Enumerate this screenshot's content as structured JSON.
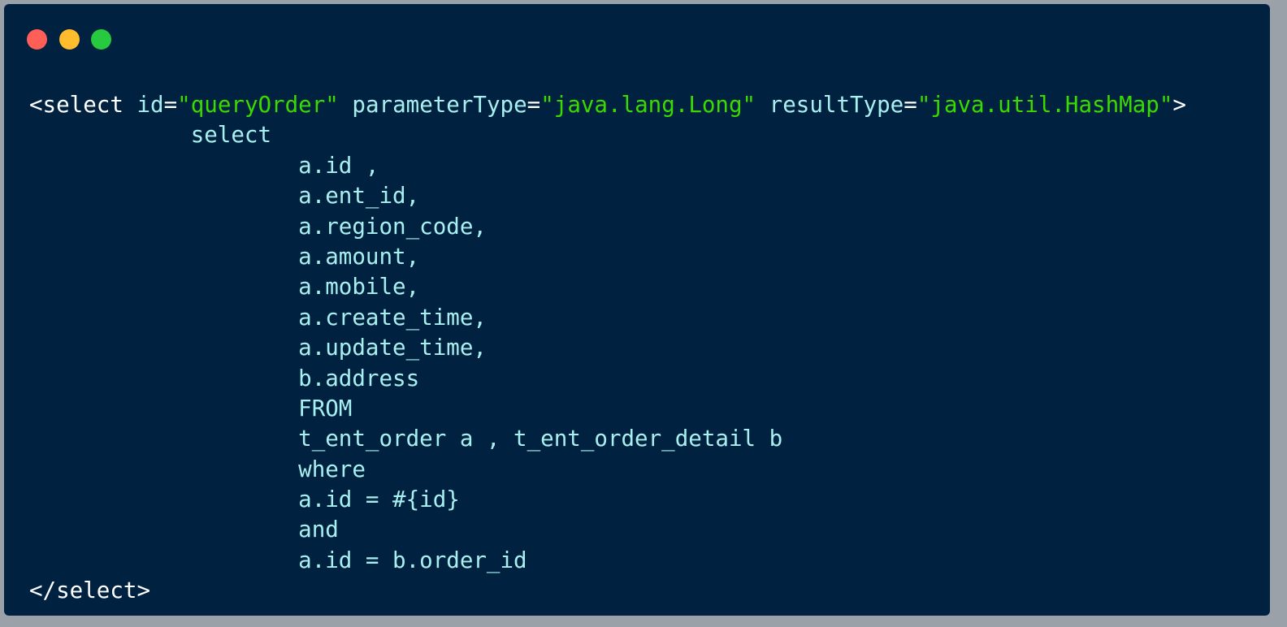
{
  "window": {
    "controls": [
      "close",
      "minimize",
      "maximize"
    ],
    "colors": {
      "background": "#002240",
      "close": "#ff5f56",
      "minimize": "#ffbd2e",
      "maximize": "#27c93f",
      "text": "#a8f0ef",
      "string": "#3ad900"
    }
  },
  "code": {
    "open_tag_start": "<select",
    "attrs": [
      {
        "name": "id",
        "value": "\"queryOrder\""
      },
      {
        "name": "parameterType",
        "value": "\"java.lang.Long\""
      },
      {
        "name": "resultType",
        "value": "\"java.util.HashMap\""
      }
    ],
    "open_tag_end": ">",
    "lines": [
      {
        "indent": "            ",
        "text": "select"
      },
      {
        "indent": "                    ",
        "text": "a.id ,"
      },
      {
        "indent": "                    ",
        "text": "a.ent_id,"
      },
      {
        "indent": "                    ",
        "text": "a.region_code,"
      },
      {
        "indent": "                    ",
        "text": "a.amount,"
      },
      {
        "indent": "                    ",
        "text": "a.mobile,"
      },
      {
        "indent": "                    ",
        "text": "a.create_time,"
      },
      {
        "indent": "                    ",
        "text": "a.update_time,"
      },
      {
        "indent": "                    ",
        "text": "b.address"
      },
      {
        "indent": "                    ",
        "text": "FROM"
      },
      {
        "indent": "                    ",
        "text": "t_ent_order a , t_ent_order_detail b"
      },
      {
        "indent": "                    ",
        "text": "where"
      },
      {
        "indent": "                    ",
        "text": "a.id = #{id}"
      },
      {
        "indent": "                    ",
        "text": "and"
      },
      {
        "indent": "                    ",
        "text": "a.id = b.order_id"
      }
    ],
    "close_tag": "</select>"
  }
}
